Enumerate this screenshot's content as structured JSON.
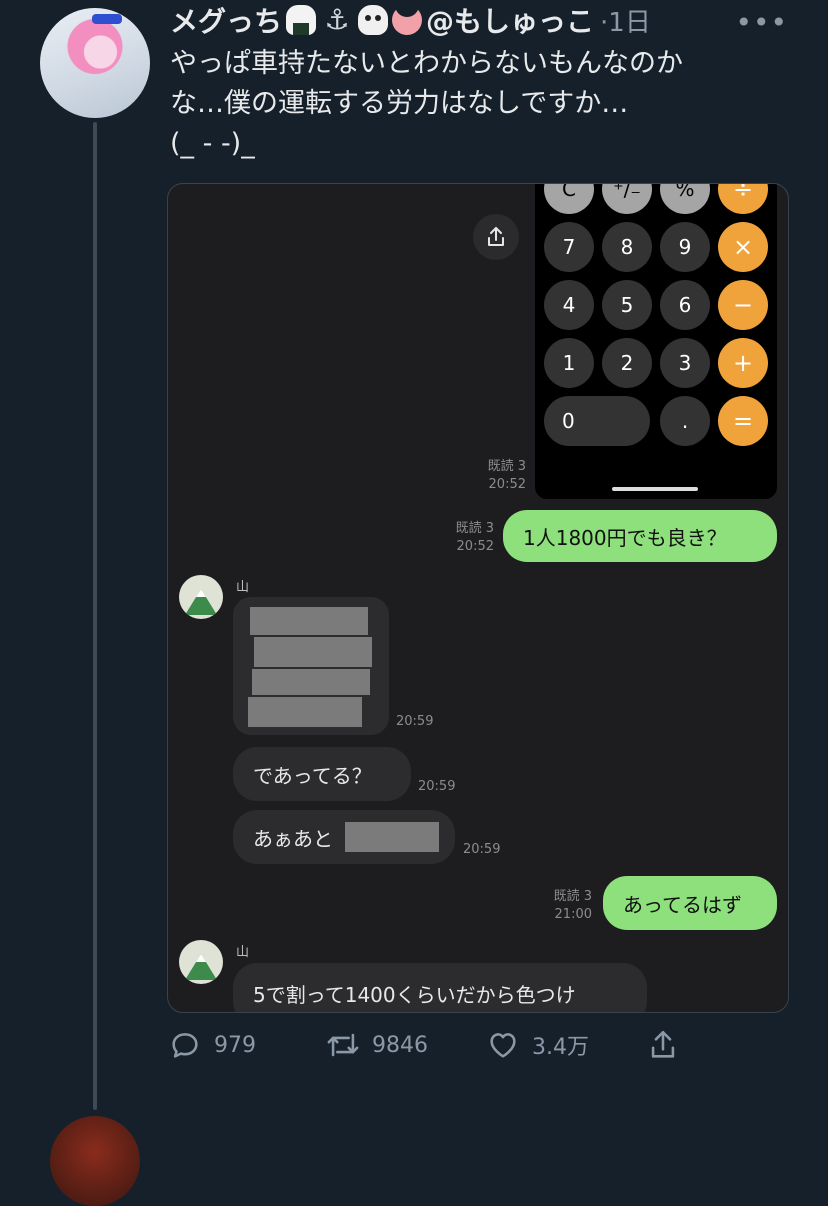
{
  "tweet": {
    "display_name": "メグっち",
    "emojis": [
      "rice-ball",
      "anchor",
      "skull",
      "tongue"
    ],
    "handle": "@もしゅっこ",
    "time": "·1日",
    "more_label": "•••",
    "text": "やっぱ車持たないとわからないもんなのか\nな…僕の運転する労力はなしですか…\n(_ - -)_"
  },
  "calculator": {
    "keys": [
      "C",
      "⁺∕₋",
      "%",
      "÷",
      "7",
      "8",
      "9",
      "×",
      "4",
      "5",
      "6",
      "−",
      "1",
      "2",
      "3",
      "+",
      "0",
      ".",
      "="
    ],
    "read_status": "既読 3",
    "read_time": "20:52"
  },
  "chat": {
    "m1": {
      "read": "既読 3",
      "time": "20:52",
      "text": "1人1800円でも良き？"
    },
    "sender1": "山",
    "blurred_time": "20:59",
    "m2": {
      "text": "であってる？",
      "time": "20:59"
    },
    "m3": {
      "text": "あぁあと",
      "time": "20:59"
    },
    "m4": {
      "read": "既読 3",
      "time": "21:00",
      "text": "あってるはず"
    },
    "sender2": "山",
    "m5": {
      "text": "5で割って1400くらいだから色つけ"
    }
  },
  "actions": {
    "reply_count": "979",
    "retweet_count": "9846",
    "like_count": "3.4万"
  },
  "colors": {
    "background": "#15202b",
    "line_green": "#8de07b",
    "calc_orange": "#f1a33b"
  }
}
